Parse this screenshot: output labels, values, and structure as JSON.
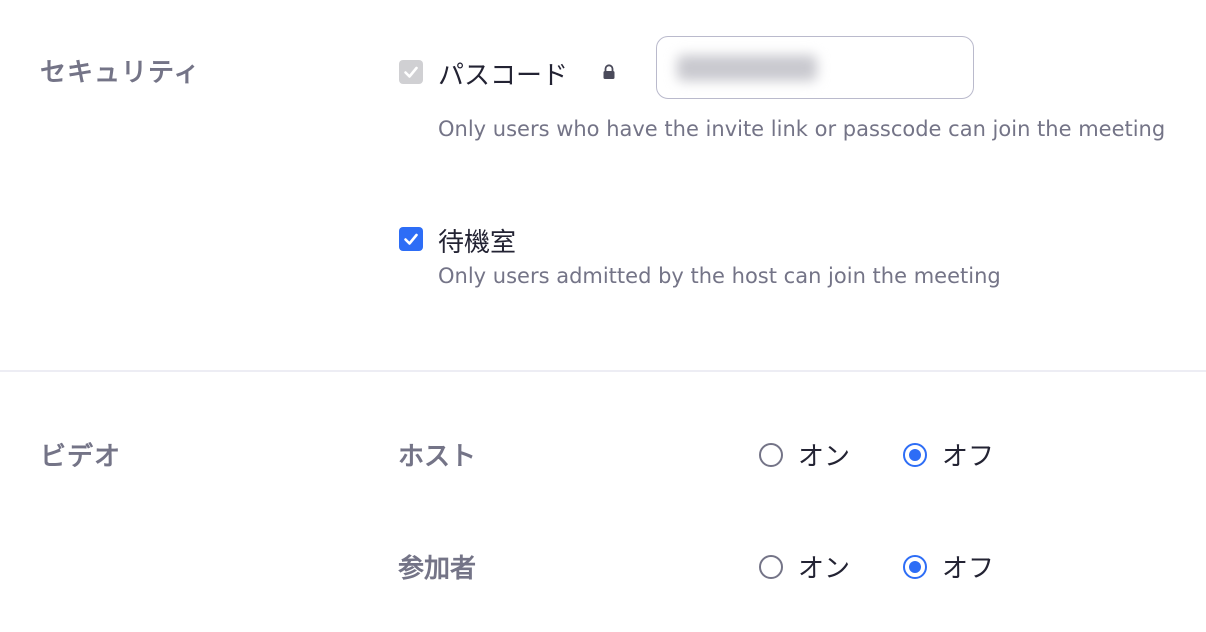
{
  "security": {
    "section_label": "セキュリティ",
    "passcode": {
      "label": "パスコード",
      "checked": true,
      "disabled": true,
      "description": "Only users who have the invite link or passcode can join the meeting"
    },
    "waiting_room": {
      "label": "待機室",
      "checked": true,
      "description": "Only users admitted by the host can join the meeting"
    }
  },
  "video": {
    "section_label": "ビデオ",
    "host": {
      "label": "ホスト",
      "on_label": "オン",
      "off_label": "オフ",
      "selected": "off"
    },
    "participants": {
      "label": "参加者",
      "on_label": "オン",
      "off_label": "オフ",
      "selected": "off"
    }
  },
  "colors": {
    "accent": "#2d6df6",
    "muted_text": "#747487",
    "primary_text": "#232333",
    "divider": "#ededf4"
  },
  "icons": {
    "lock": "lock-icon",
    "check": "checkmark-icon"
  }
}
